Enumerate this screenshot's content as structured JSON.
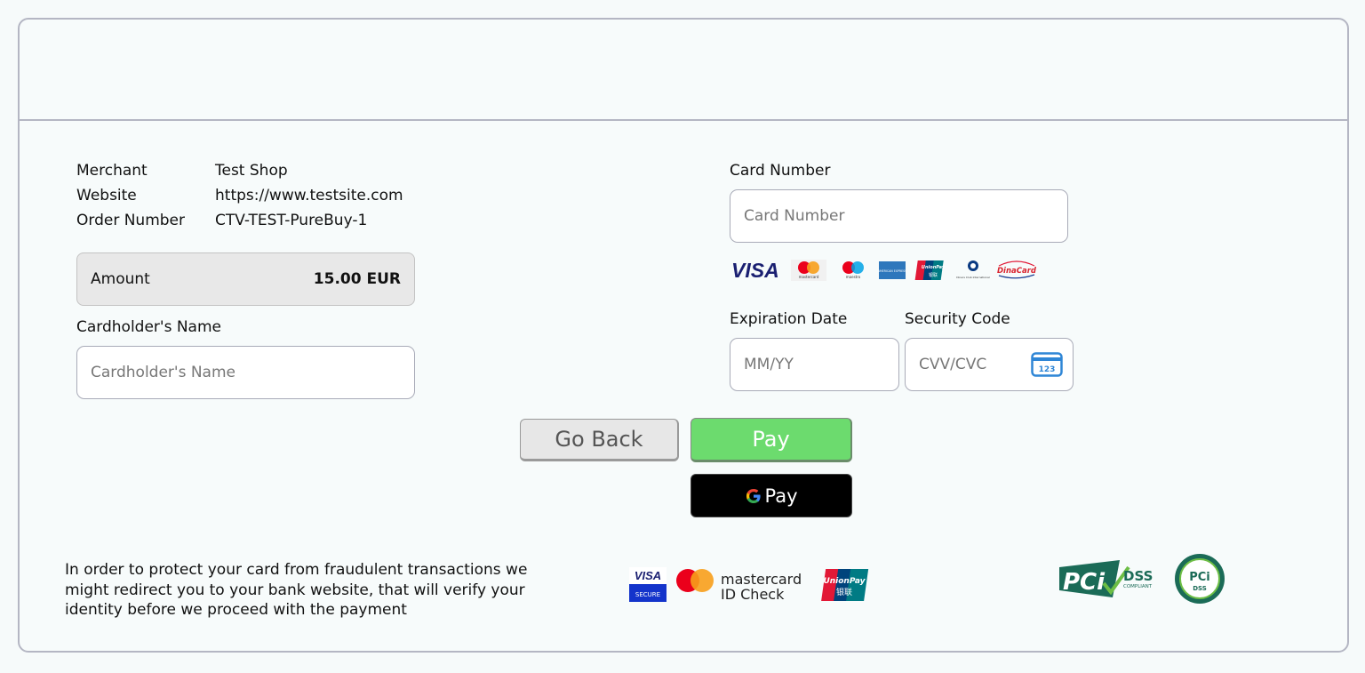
{
  "order": {
    "merchant_label": "Merchant",
    "merchant_value": "Test Shop",
    "website_label": "Website",
    "website_value": "https://www.testsite.com",
    "order_label": "Order Number",
    "order_value": "CTV-TEST-PureBuy-1"
  },
  "amount": {
    "label": "Amount",
    "value": "15.00 EUR"
  },
  "cardholder": {
    "label": "Cardholder's Name",
    "placeholder": "Cardholder's Name"
  },
  "card_number": {
    "label": "Card Number",
    "placeholder": "Card Number"
  },
  "expiration": {
    "label": "Expiration Date",
    "placeholder": "MM/YY"
  },
  "security": {
    "label": "Security Code",
    "placeholder": "CVV/CVC",
    "icon_text": "123"
  },
  "brands": {
    "visa": "VISA",
    "mastercard_small": "mastercard",
    "maestro_small": "maestro",
    "amex_small": "AMERICAN EXPRESS",
    "unionpay_small": "UnionPay",
    "unionpay_cn": "银联",
    "diners_small": "Diners Club International",
    "dinacard": "DinaCard"
  },
  "buttons": {
    "back": "Go Back",
    "pay": "Pay",
    "gpay_text": "Pay",
    "gpay_g": "G"
  },
  "notice": {
    "text": "In order to protect your card from fraudulent transactions we might redirect you to your bank website, that will verify your identity before we proceed with the payment"
  },
  "secure_badges": {
    "visa_top": "VISA",
    "visa_bottom": "SECURE",
    "mc_line1": "mastercard",
    "mc_line2": "ID Check",
    "unionpay": "UnionPay",
    "unionpay_cn": "银联"
  },
  "pci": {
    "pci": "PCi",
    "dss": "DSS",
    "compliant": "COMPLIANT",
    "seal_pci": "PCi",
    "seal_dss": "DSS"
  },
  "colors": {
    "pay_green": "#6cdb6e",
    "border": "#b4b6c3",
    "visa_blue": "#1a1f71",
    "pci_green": "#1b6b57"
  }
}
